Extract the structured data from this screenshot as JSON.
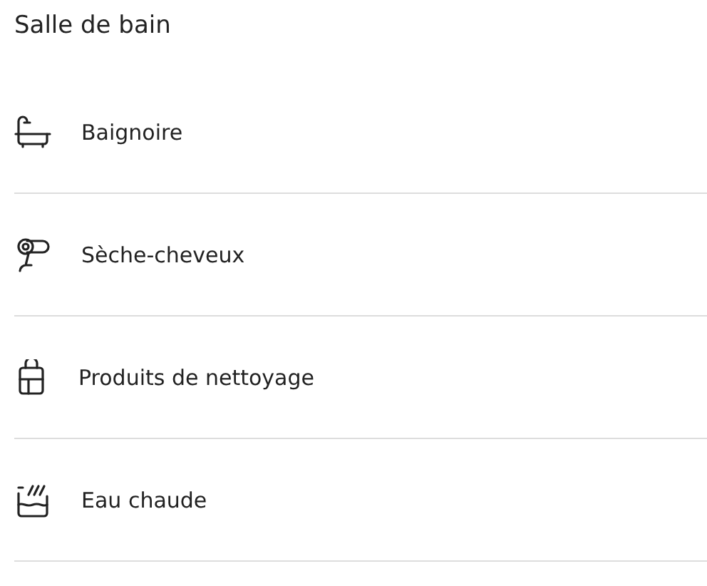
{
  "title": "Salle de bain",
  "items": [
    {
      "kind": "bathtub",
      "label": "Baignoire"
    },
    {
      "kind": "hairdryer",
      "label": "Sèche-cheveux"
    },
    {
      "kind": "cleaning",
      "label": "Produits de nettoyage"
    },
    {
      "kind": "hotwater",
      "label": "Eau chaude"
    }
  ]
}
